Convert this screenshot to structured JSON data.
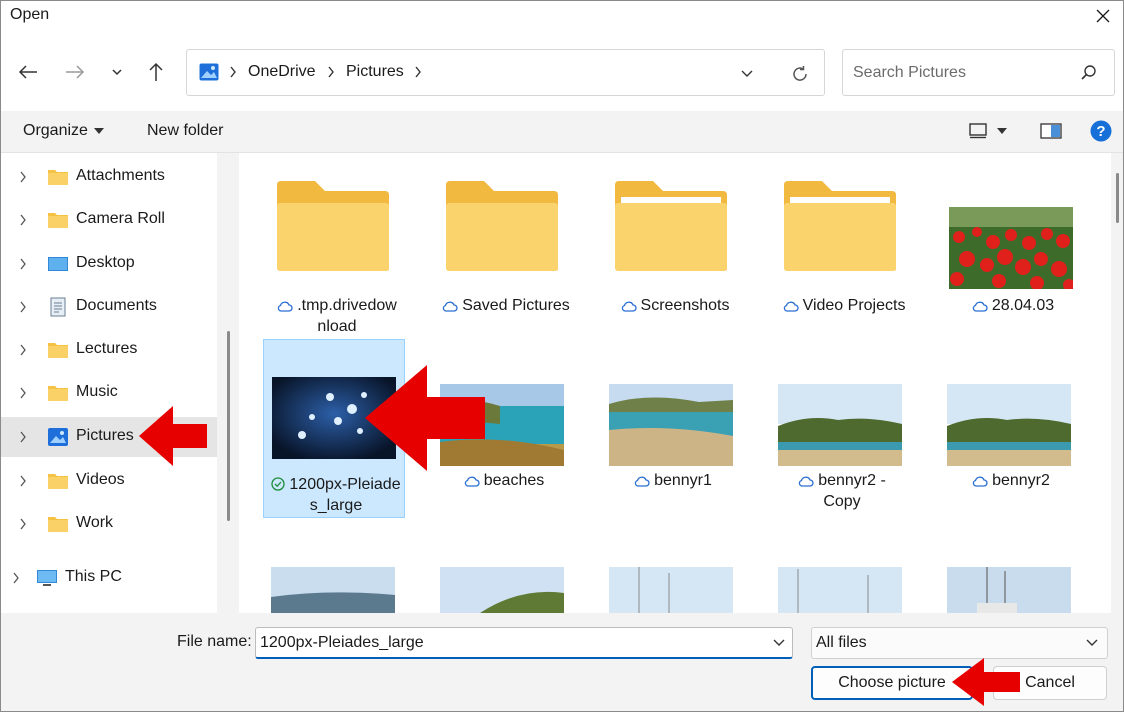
{
  "window": {
    "title": "Open"
  },
  "breadcrumb": {
    "items": [
      "OneDrive",
      "Pictures"
    ]
  },
  "search": {
    "placeholder": "Search Pictures"
  },
  "toolbar": {
    "organize_label": "Organize",
    "new_folder_label": "New folder"
  },
  "sidebar": {
    "items": [
      {
        "label": "Attachments",
        "icon": "folder-icon"
      },
      {
        "label": "Camera Roll",
        "icon": "folder-icon"
      },
      {
        "label": "Desktop",
        "icon": "desktop-icon"
      },
      {
        "label": "Documents",
        "icon": "documents-icon"
      },
      {
        "label": "Lectures",
        "icon": "folder-icon"
      },
      {
        "label": "Music",
        "icon": "folder-icon"
      },
      {
        "label": "Pictures",
        "icon": "pictures-icon",
        "selected": true
      },
      {
        "label": "Videos",
        "icon": "folder-icon"
      },
      {
        "label": "Work",
        "icon": "folder-icon"
      }
    ],
    "this_pc_label": "This PC"
  },
  "files": {
    "row1": [
      {
        "name": ".tmp.drivedow\nnload",
        "kind": "folder",
        "status": "cloud-icon"
      },
      {
        "name": "Saved Pictures",
        "kind": "folder",
        "status": "cloud-icon"
      },
      {
        "name": "Screenshots",
        "kind": "folder",
        "status": "cloud-icon"
      },
      {
        "name": "Video Projects",
        "kind": "folder",
        "status": "cloud-icon"
      },
      {
        "name": "28.04.03",
        "kind": "image-poppies",
        "status": "cloud-icon"
      }
    ],
    "row2": [
      {
        "name": "1200px-Pleiade\ns_large",
        "kind": "image-stars",
        "status": "check-icon",
        "selected": true
      },
      {
        "name": "beaches",
        "kind": "image-bay",
        "status": "cloud-icon"
      },
      {
        "name": "bennyr1",
        "kind": "image-beach",
        "status": "cloud-icon"
      },
      {
        "name": "bennyr2 -\nCopy",
        "kind": "image-coast",
        "status": "cloud-icon"
      },
      {
        "name": "bennyr2",
        "kind": "image-coast",
        "status": "cloud-icon"
      }
    ]
  },
  "footer": {
    "file_name_label": "File name:",
    "file_name_value": "1200px-Pleiades_large",
    "file_type_value": "All files",
    "choose_label": "Choose picture",
    "cancel_label": "Cancel"
  },
  "colors": {
    "accent": "#005fb8",
    "selection": "#cce8ff",
    "annotation_arrow": "#e60000",
    "folder": "#f8c95a"
  }
}
